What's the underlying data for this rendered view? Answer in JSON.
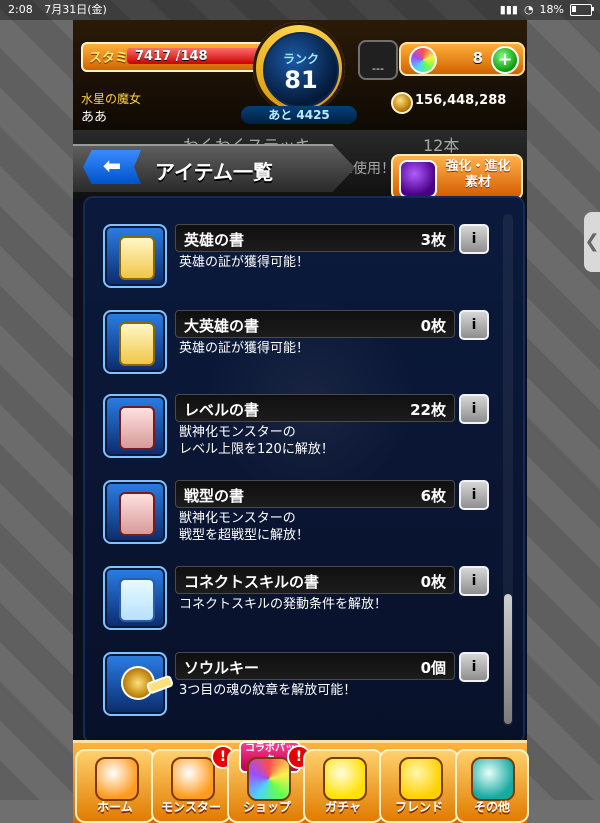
{
  "status_bar": {
    "time": "2:08",
    "date": "7月31日(金)",
    "battery": "18%"
  },
  "top": {
    "stamina_label": "スタミナ",
    "stamina": "7417 /148",
    "stamina_percent": 100,
    "rank_label": "ランク",
    "rank_value": "81",
    "to_next": "あと 4425",
    "slot_text": "---",
    "orb_count": "8",
    "player_title": "水星の魔女",
    "player_name": "ああ",
    "coins": "156,448,288"
  },
  "header": {
    "back_icon": "back-arrow-icon",
    "title": "アイテム一覧",
    "behind_item_name": "わくわくステッキ",
    "behind_item_count": "12本",
    "behind_item_desc": "の付替えに使用！",
    "evolve_button": "強化・進化\n素材"
  },
  "items": [
    {
      "name": "英雄の書",
      "count": "3枚",
      "desc": "英雄の証が獲得可能！",
      "icon": "scroll-icon",
      "variant": "gold"
    },
    {
      "name": "大英雄の書",
      "count": "0枚",
      "desc": "英雄の証が獲得可能！",
      "icon": "scroll-icon",
      "variant": "gold"
    },
    {
      "name": "レベルの書",
      "count": "22枚",
      "desc": "獣神化モンスターの\nレベル上限を120に解放！",
      "icon": "scroll-icon",
      "variant": "red"
    },
    {
      "name": "戦型の書",
      "count": "6枚",
      "desc": "獣神化モンスターの\n戦型を超戦型に解放！",
      "icon": "scroll-icon",
      "variant": "red"
    },
    {
      "name": "コネクトスキルの書",
      "count": "0枚",
      "desc": "コネクトスキルの発動条件を解放！",
      "icon": "scroll-icon",
      "variant": "blue"
    },
    {
      "name": "ソウルキー",
      "count": "0個",
      "desc": "3つ目の魂の紋章を解放可能！",
      "icon": "key-icon",
      "variant": "key"
    }
  ],
  "nav": [
    {
      "label": "ホーム",
      "icon": "home-icon"
    },
    {
      "label": "モンスター",
      "icon": "monster-icon",
      "alert": "!"
    },
    {
      "label": "ショップ",
      "icon": "shop-icon",
      "alert": "!",
      "tag": "コラボパック\n登場！"
    },
    {
      "label": "ガチャ",
      "icon": "gacha-icon"
    },
    {
      "label": "フレンド",
      "icon": "friend-icon"
    },
    {
      "label": "その他",
      "icon": "other-icon"
    }
  ],
  "ui": {
    "info_label": "i"
  }
}
